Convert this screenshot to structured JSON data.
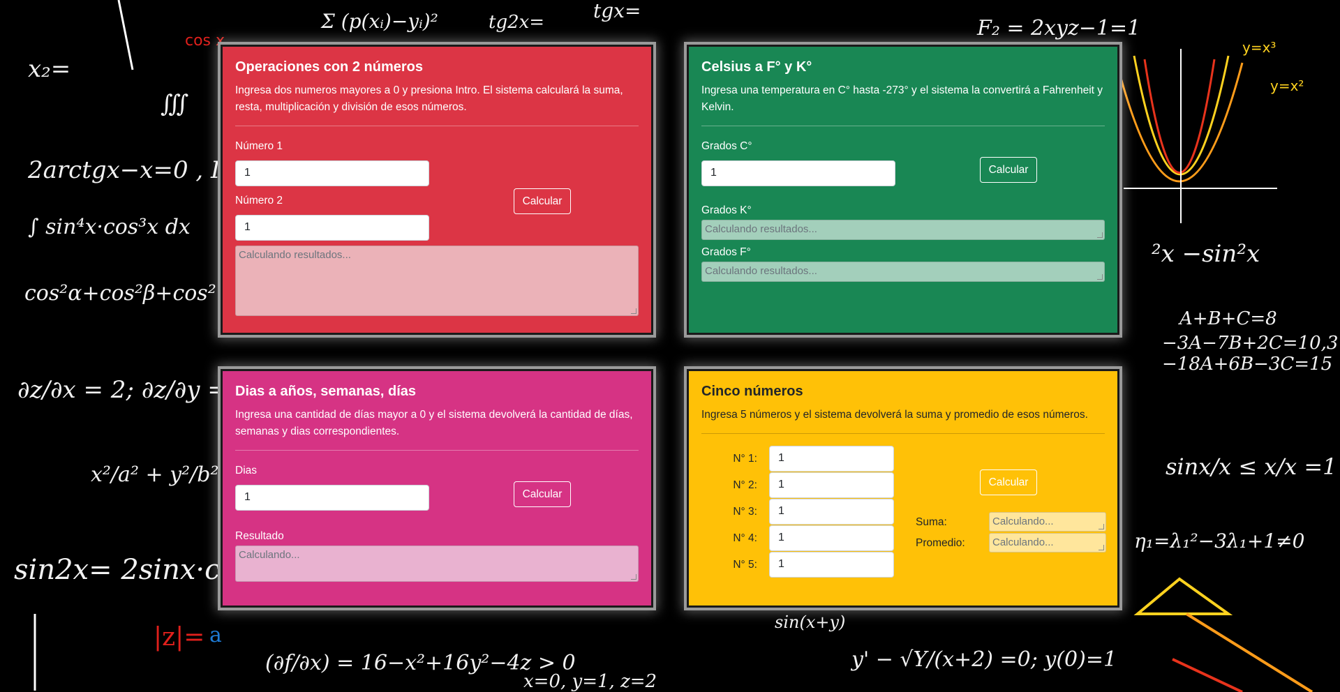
{
  "cards": {
    "operations": {
      "title": "Operaciones con 2 números",
      "description": "Ingresa dos numeros mayores a 0 y presiona Intro. El sistema calculará la suma, resta, multiplicación y división de esos números.",
      "label1": "Número 1",
      "value1": "1",
      "label2": "Número 2",
      "value2": "1",
      "output_placeholder": "Calculando resultados...",
      "button": "Calcular",
      "color": "#dc3545"
    },
    "celsius": {
      "title": "Celsius a F° y K°",
      "description": "Ingresa una temperatura en C° hasta -273° y el sistema la convertirá a Fahrenheit y Kelvin.",
      "label_c": "Grados C°",
      "value_c": "1",
      "button": "Calcular",
      "label_k": "Grados K°",
      "placeholder_k": "Calculando resultados...",
      "label_f": "Grados F°",
      "placeholder_f": "Calculando resultados...",
      "color": "#198754"
    },
    "days": {
      "title": "Dias a años, semanas, días",
      "description": "Ingresa una cantidad de días mayor a 0 y el sistema devolverá la cantidad de días, semanas y dias correspondientes.",
      "label_days": "Dias",
      "value_days": "1",
      "button": "Calcular",
      "label_result": "Resultado",
      "placeholder_result": "Calculando...",
      "color": "#d63384"
    },
    "five": {
      "title": "Cinco números",
      "description": "Ingresa 5 números y el sistema devolverá la suma y promedio de esos números.",
      "fields": [
        {
          "label": "N° 1:",
          "value": "1"
        },
        {
          "label": "N° 2:",
          "value": "1"
        },
        {
          "label": "N° 3:",
          "value": "1"
        },
        {
          "label": "N° 4:",
          "value": "1"
        },
        {
          "label": "N° 5:",
          "value": "1"
        }
      ],
      "button": "Calcular",
      "label_sum": "Suma:",
      "placeholder_sum": "Calculando...",
      "label_avg": "Promedio:",
      "placeholder_avg": "Calculando...",
      "color": "#ffc107"
    }
  }
}
